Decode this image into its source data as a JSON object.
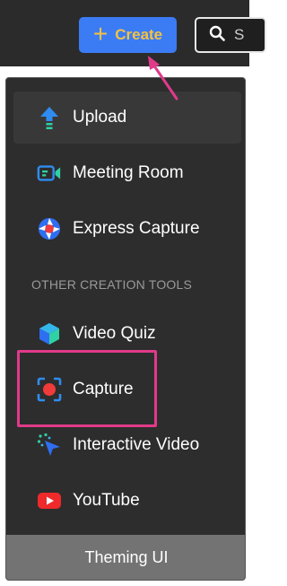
{
  "toolbar": {
    "create_label": "Create",
    "search_text": "S"
  },
  "menu": {
    "items_top": [
      {
        "label": "Upload",
        "icon": "upload-icon"
      },
      {
        "label": "Meeting Room",
        "icon": "meeting-room-icon"
      },
      {
        "label": "Express Capture",
        "icon": "express-capture-icon"
      }
    ],
    "section_label": "OTHER CREATION TOOLS",
    "items_tools": [
      {
        "label": "Video Quiz",
        "icon": "video-quiz-icon"
      },
      {
        "label": "Capture",
        "icon": "capture-icon"
      },
      {
        "label": "Interactive Video",
        "icon": "interactive-video-icon"
      },
      {
        "label": "YouTube",
        "icon": "youtube-icon"
      }
    ],
    "footer_label": "Theming UI"
  },
  "colors": {
    "topbar": "#2b2b2b",
    "create_button": "#3b7cf5",
    "create_text": "#f5c242",
    "panel": "#2d2d2d",
    "highlight": "#e13a8a",
    "footer": "#737373"
  }
}
